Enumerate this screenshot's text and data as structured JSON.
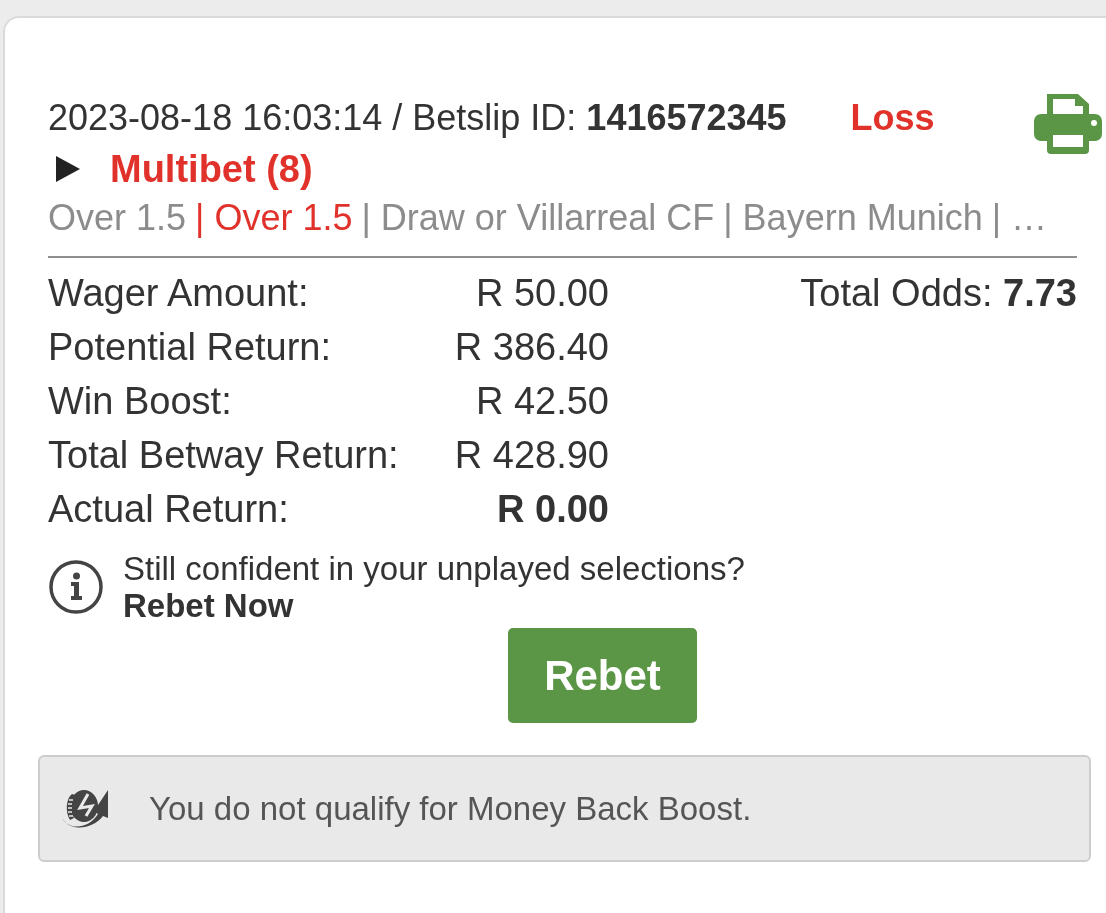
{
  "bet": {
    "header": "2023-08-18 16:03:14 / Betslip ID: **1416572345**",
    "result": "Loss",
    "lost": true
  },
  "multibet": {
    "title": "Multibet (8)",
    "expanded": false
  },
  "selections": {
    "separator": "|",
    "items": [
      {
        "text": "Over 1.5",
        "lost": false
      },
      {
        "text": "Over 1.5",
        "lost": true
      },
      {
        "text": "Draw or Villarreal CF",
        "lost": false
      },
      {
        "text": "Bayern Munich",
        "lost": false
      },
      {
        "text": "…",
        "lost": false
      }
    ]
  },
  "summary": [
    {
      "label": "Wager Amount:",
      "value": "R 50.00",
      "emphasis": false
    },
    {
      "label": "Potential Return:",
      "value": "R 386.40",
      "emphasis": false
    },
    {
      "label": "Win Boost:",
      "value": "R 42.50",
      "emphasis": false
    },
    {
      "label": "Total Betway Return:",
      "value": "R 428.90",
      "emphasis": false
    },
    {
      "label": "Actual Return:",
      "value": "R 0.00",
      "emphasis": true
    }
  ],
  "total_odds": "Total Odds: **7.73**",
  "rebet_prompt": {
    "text": "Still confident in your unplayed selections?",
    "link": "Rebet Now"
  },
  "rebet_button": "Rebet",
  "notice": "You do not qualify for Money Back Boost."
}
